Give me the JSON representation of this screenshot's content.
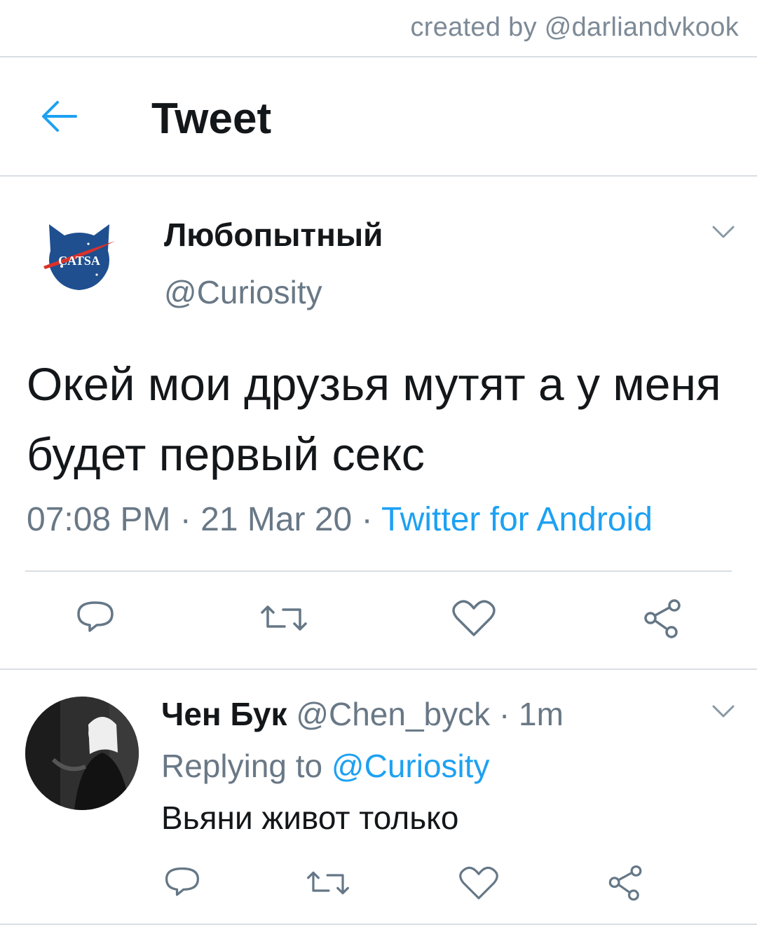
{
  "credit": "created by @darliandvkook",
  "header": {
    "title": "Tweet"
  },
  "tweet": {
    "author_name": "Любопытный",
    "author_handle": "@Curiosity",
    "avatar_text": "CATSA",
    "text": "Окей мои друзья мутят а у меня будет первый секс",
    "time": "07:08 PM",
    "date": "21 Mar 20",
    "separator": "·",
    "source": "Twitter for Android"
  },
  "reply": {
    "author_name": "Чен Бук",
    "author_handle": "@Chen_byck",
    "time_ago": "1m",
    "replying_prefix": "Replying to",
    "replying_to": "@Curiosity",
    "text": "Вьяни живот только"
  },
  "icons": [
    "back-arrow-icon",
    "chevron-down-icon",
    "reply-icon",
    "retweet-icon",
    "like-icon",
    "share-icon"
  ],
  "colors": {
    "accent": "#1da1f2",
    "secondary_text": "#697886",
    "divider": "#d9dee3",
    "icon": "#657786",
    "logo_blue": "#1f4f8f",
    "logo_red": "#d9322b"
  }
}
